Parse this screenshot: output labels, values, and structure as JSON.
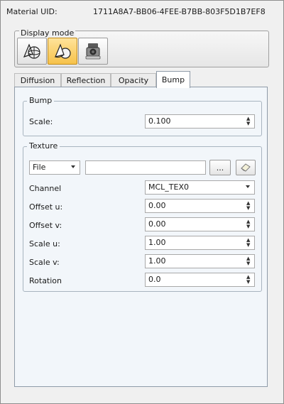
{
  "material": {
    "uid_label": "Material UID:",
    "uid_value": "1711A8A7-BB06-4FEE-B7BB-803F5D1B7EF8"
  },
  "display_mode": {
    "title": "Display mode",
    "buttons": [
      {
        "icon": "wireframe-shapes-icon",
        "active": false
      },
      {
        "icon": "solid-shapes-icon",
        "active": true
      },
      {
        "icon": "camera-render-icon",
        "active": false
      }
    ]
  },
  "tabs": [
    "Diffusion",
    "Reflection",
    "Opacity",
    "Bump"
  ],
  "active_tab": "Bump",
  "bump": {
    "title": "Bump",
    "scale_label": "Scale:",
    "scale_value": "0.100"
  },
  "texture": {
    "title": "Texture",
    "source_value": "File",
    "path_value": "",
    "browse_label": "...",
    "clear_icon": "eraser-icon",
    "rows": [
      {
        "label": "Channel",
        "value": "MCL_TEX0",
        "kind": "dropdown"
      },
      {
        "label": "Offset u:",
        "value": "0.00",
        "kind": "spin"
      },
      {
        "label": "Offset v:",
        "value": "0.00",
        "kind": "spin"
      },
      {
        "label": "Scale u:",
        "value": "1.00",
        "kind": "spin"
      },
      {
        "label": "Scale v:",
        "value": "1.00",
        "kind": "spin"
      },
      {
        "label": "Rotation",
        "value": "0.0",
        "kind": "spin"
      }
    ]
  },
  "colors": {
    "accent": "#f6c24a",
    "panel_bg": "#f2f6fa",
    "window_bg": "#f0f0f0"
  }
}
